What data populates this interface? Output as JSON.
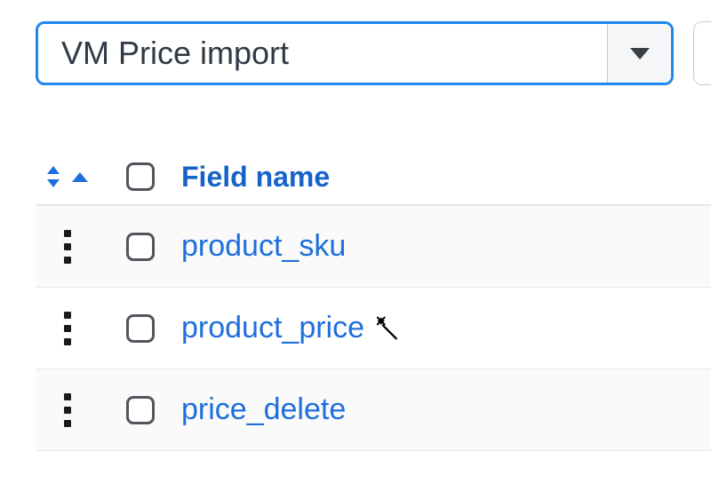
{
  "dropdown": {
    "selected": "VM Price import"
  },
  "table": {
    "header": {
      "field_name": "Field name"
    },
    "rows": [
      {
        "name": "product_sku",
        "wand": false
      },
      {
        "name": "product_price",
        "wand": true
      },
      {
        "name": "price_delete",
        "wand": false
      }
    ]
  }
}
